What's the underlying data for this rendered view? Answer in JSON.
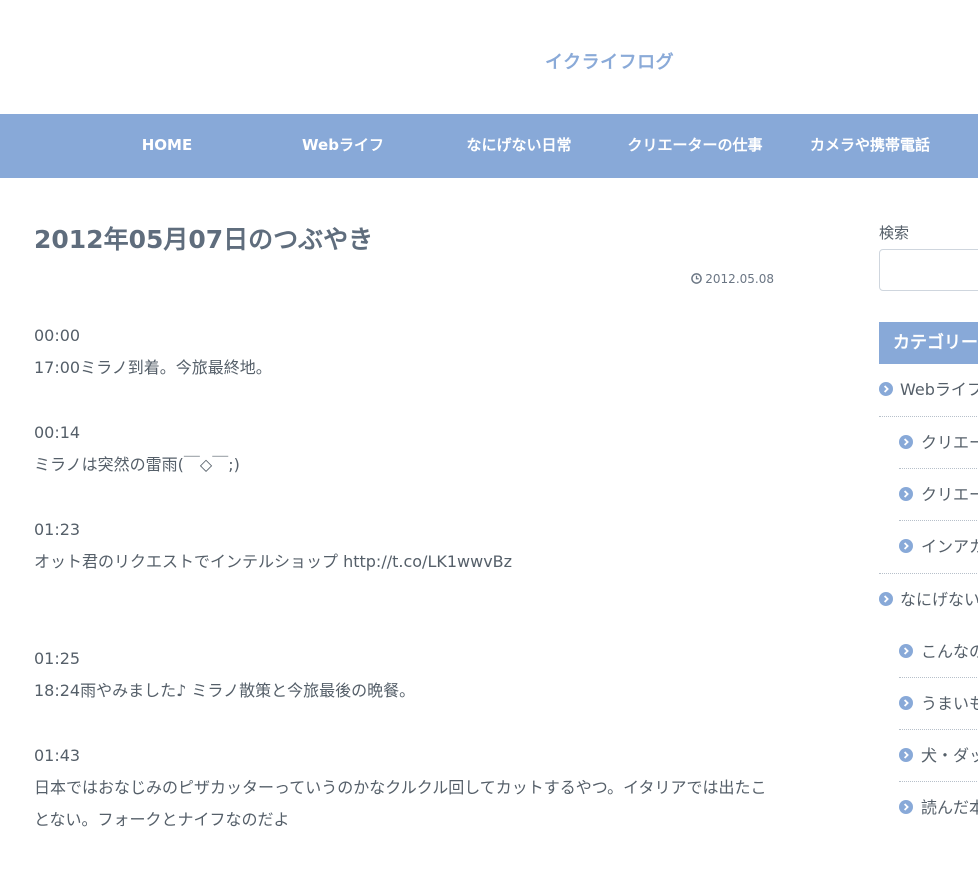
{
  "site": {
    "title": "イクライフログ"
  },
  "nav": [
    {
      "label": "HOME"
    },
    {
      "label": "Webライフ"
    },
    {
      "label": "なにげない日常"
    },
    {
      "label": "クリエーターの仕事"
    },
    {
      "label": "カメラや携帯電話"
    }
  ],
  "post": {
    "title": "2012年05月07日のつぶやき",
    "date": "2012.05.08",
    "tweets": [
      {
        "time": "00:00",
        "text": "17:00ミラノ到着。今旅最終地。"
      },
      {
        "time": "00:14",
        "text": "ミラノは突然の雷雨(￣◇￣;)"
      },
      {
        "time": "01:23",
        "text": "オット君のリクエストでインテルショップ http://t.co/LK1wwvBz"
      },
      {
        "time": "01:25",
        "text": "18:24雨やみました♪ ミラノ散策と今旅最後の晩餐。"
      },
      {
        "time": "01:43",
        "text": "日本ではおなじみのピザカッターっていうのかなクルクル回してカットするやつ。イタリアでは出たことない。フォークとナイフなのだよ"
      }
    ]
  },
  "sidebar": {
    "search_label": "検索",
    "search_value": "",
    "category_title": "カテゴリー",
    "categories": [
      {
        "label": "Webライフ"
      },
      {
        "label": "クリエー"
      },
      {
        "label": "クリエー"
      },
      {
        "label": "インアカ"
      },
      {
        "label": "なにげない"
      },
      {
        "label": "こんなの"
      },
      {
        "label": "うまいも"
      },
      {
        "label": "犬・ダッ"
      },
      {
        "label": "読んだ本"
      }
    ]
  },
  "colors": {
    "accent": "#88a9d8",
    "title_text": "#5f6d7d",
    "body_text": "#555f69"
  },
  "icons": {
    "date": "clock-icon",
    "category": "chevron-right-circle-icon"
  }
}
